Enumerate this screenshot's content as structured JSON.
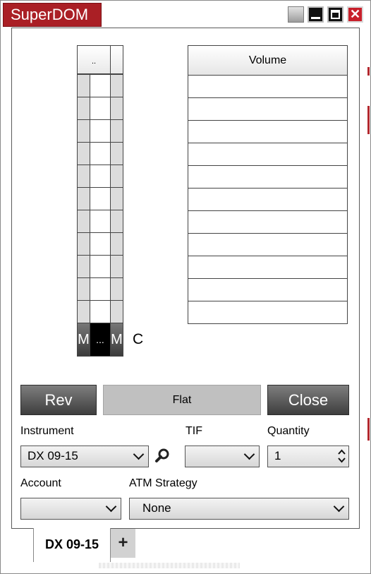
{
  "window": {
    "title": "SuperDOM",
    "close_glyph": "✕"
  },
  "ladder": {
    "header_text": "..",
    "rows": 11,
    "footer_left": "M",
    "footer_mid": "...",
    "footer_right": "M",
    "side_label": "C"
  },
  "volume": {
    "header": "Volume",
    "rows": 11
  },
  "actions": {
    "rev_label": "Rev",
    "flat_label": "Flat",
    "close_label": "Close"
  },
  "form": {
    "instrument_label": "Instrument",
    "instrument_value": "DX 09-15",
    "tif_label": "TIF",
    "tif_value": "",
    "quantity_label": "Quantity",
    "quantity_value": "1",
    "account_label": "Account",
    "account_value": "",
    "atm_label": "ATM Strategy",
    "atm_value": "None"
  },
  "tabs": {
    "active_tab": "DX 09-15",
    "add_glyph": "+"
  },
  "colors": {
    "title_bar": "#aa1f25",
    "dark_button": "#4a4a4a",
    "flat_button": "#c0c0c0"
  }
}
